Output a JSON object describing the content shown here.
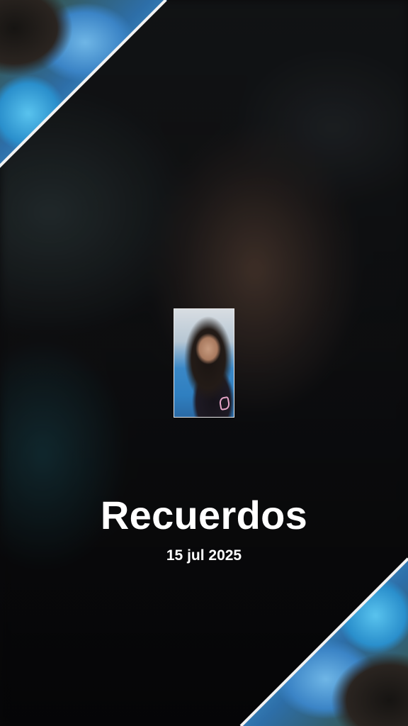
{
  "memory": {
    "title": "Recuerdos",
    "date": "15 jul 2025"
  }
}
